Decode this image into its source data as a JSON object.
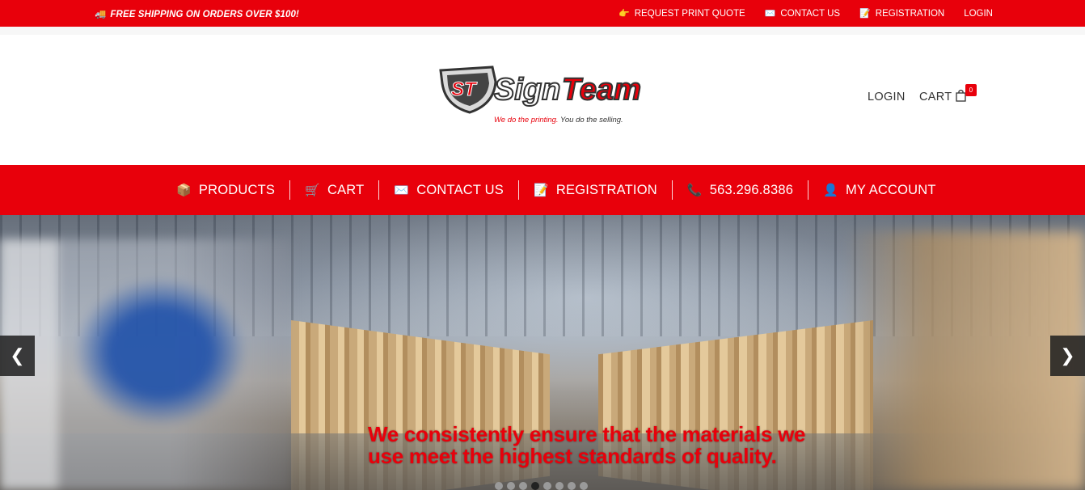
{
  "colors": {
    "brand_red": "#e8000b",
    "text_dark": "#333333"
  },
  "topbar": {
    "promo": {
      "icon": "truck-icon",
      "text": "FREE SHIPPING ON ORDERS OVER $100!"
    },
    "links": [
      {
        "icon": "pointing-hand-icon",
        "label": "REQUEST PRINT QUOTE"
      },
      {
        "icon": "envelope-icon",
        "label": "CONTACT US"
      },
      {
        "icon": "document-icon",
        "label": "REGISTRATION"
      },
      {
        "icon": "",
        "label": "LOGIN"
      }
    ]
  },
  "header": {
    "logo": {
      "mark": "ST",
      "word_sign": "Sign",
      "word_team": "Team",
      "tagline_red": "We do the printing.",
      "tagline_dark": " You do the selling."
    },
    "login_label": "LOGIN",
    "cart_label": "CART",
    "cart_count": "0"
  },
  "mainnav": {
    "items": [
      {
        "icon": "package-icon",
        "label": "PRODUCTS"
      },
      {
        "icon": "cart-icon",
        "label": "CART"
      },
      {
        "icon": "envelope-icon",
        "label": "CONTACT US"
      },
      {
        "icon": "document-icon",
        "label": "REGISTRATION"
      },
      {
        "icon": "phone-icon",
        "label": "563.296.8386"
      },
      {
        "icon": "user-icon",
        "label": "MY ACCOUNT"
      }
    ]
  },
  "hero": {
    "caption_line1": "We consistently ensure that the materials we",
    "caption_line2": "use meet the highest standards of quality.",
    "prev_icon": "chevron-left-icon",
    "next_icon": "chevron-right-icon",
    "slide_count": 8,
    "active_slide": 4
  }
}
